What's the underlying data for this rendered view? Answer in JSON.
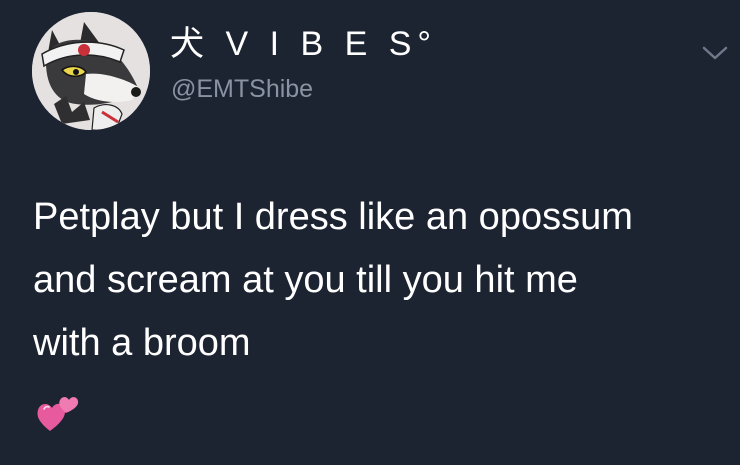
{
  "tweet": {
    "author": {
      "display_name": "犬 V I B E S°",
      "handle": "@EMTShibe",
      "avatar_icon": "wolf-avatar-icon"
    },
    "menu_icon": "chevron-down-icon",
    "text_lines": [
      "Petplay but I dress like an opossum",
      "and scream at you till you hit me",
      "with a broom"
    ],
    "emoji": "revolving-hearts-icon"
  },
  "colors": {
    "background": "#1c2331",
    "text_primary": "#ffffff",
    "text_secondary": "#8a93a3",
    "emoji_pink": "#e85a9e"
  }
}
